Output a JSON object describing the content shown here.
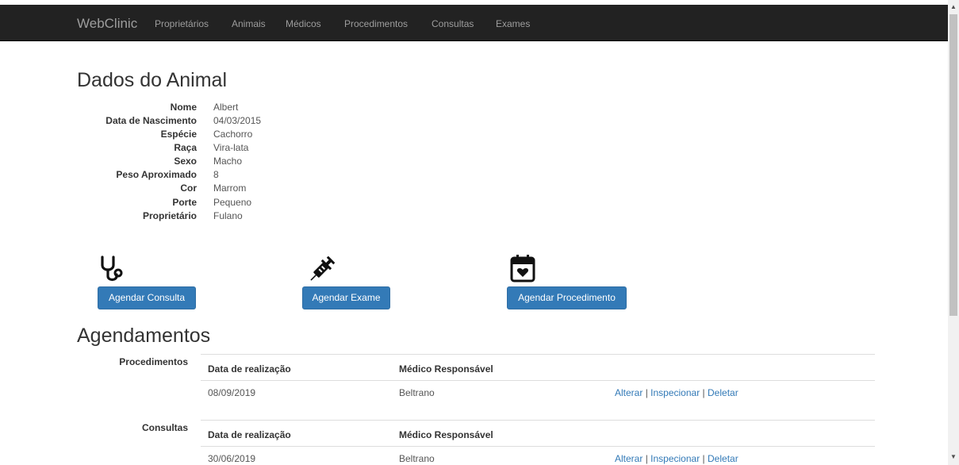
{
  "navbar": {
    "brand": "WebClinic",
    "items": [
      "Proprietários",
      "Animais",
      "Médicos",
      "Procedimentos",
      "Consultas",
      "Exames"
    ]
  },
  "page": {
    "title": "Dados do Animal"
  },
  "animal": [
    {
      "label": "Nome",
      "value": "Albert"
    },
    {
      "label": "Data de Nascimento",
      "value": "04/03/2015"
    },
    {
      "label": "Espécie",
      "value": "Cachorro"
    },
    {
      "label": "Raça",
      "value": "Vira-lata"
    },
    {
      "label": "Sexo",
      "value": "Macho"
    },
    {
      "label": "Peso Aproximado",
      "value": "8"
    },
    {
      "label": "Cor",
      "value": "Marrom"
    },
    {
      "label": "Porte",
      "value": "Pequeno"
    },
    {
      "label": "Proprietário",
      "value": "Fulano"
    }
  ],
  "actions": {
    "consulta": {
      "label": "Agendar Consulta",
      "icon": "stethoscope-icon"
    },
    "exame": {
      "label": "Agendar Exame",
      "icon": "syringe-icon"
    },
    "procedimento": {
      "label": "Agendar Procedimento",
      "icon": "calendar-heart-icon"
    }
  },
  "agendamentos": {
    "title": "Agendamentos",
    "procedimentos": {
      "label": "Procedimentos",
      "headers": [
        "Data de realização",
        "Médico Responsável"
      ],
      "rows": [
        {
          "date": "08/09/2019",
          "doctor": "Beltrano",
          "alterar": "Alterar",
          "inspecionar": "Inspecionar",
          "deletar": "Deletar"
        }
      ]
    },
    "consultas": {
      "label": "Consultas",
      "headers": [
        "Data de realização",
        "Médico Responsável"
      ],
      "rows": [
        {
          "date": "30/06/2019",
          "doctor": "Beltrano",
          "alterar": "Alterar",
          "inspecionar": "Inspecionar",
          "deletar": "Deletar"
        }
      ]
    }
  },
  "colors": {
    "navbar_bg": "#222222",
    "nav_text": "#9d9d9d",
    "primary": "#337ab7",
    "link": "#337ab7"
  }
}
